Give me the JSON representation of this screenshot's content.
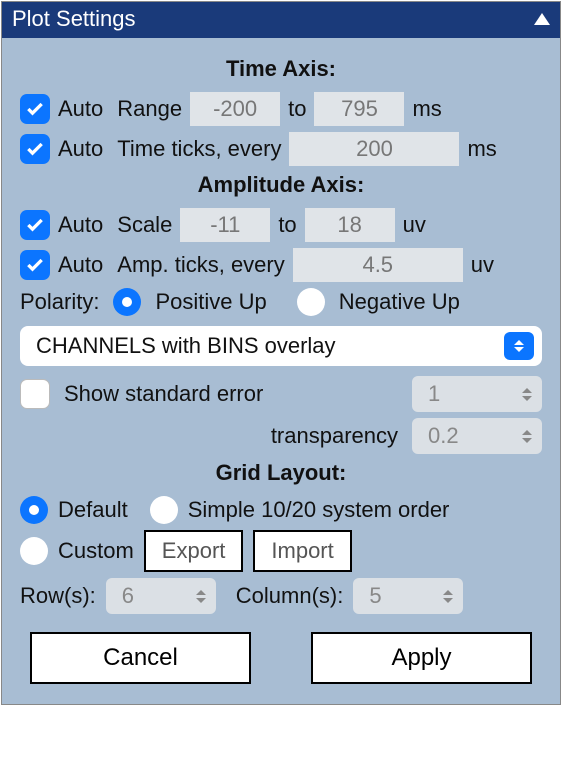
{
  "title": "Plot Settings",
  "time": {
    "heading": "Time Axis:",
    "auto_range": "Auto",
    "range_label": "Range",
    "range_from": "-200",
    "to_label": "to",
    "range_to": "795",
    "range_unit": "ms",
    "auto_ticks": "Auto",
    "ticks_label": "Time ticks, every",
    "ticks_value": "200",
    "ticks_unit": "ms"
  },
  "amp": {
    "heading": "Amplitude Axis:",
    "auto_scale": "Auto",
    "scale_label": "Scale",
    "scale_from": "-11",
    "to_label": "to",
    "scale_to": "18",
    "scale_unit": "uv",
    "auto_ticks": "Auto",
    "ticks_label": "Amp. ticks, every",
    "ticks_value": "4.5",
    "ticks_unit": "uv"
  },
  "polarity": {
    "label": "Polarity:",
    "pos": "Positive Up",
    "neg": "Negative Up"
  },
  "overlay_select": "CHANNELS with BINS overlay",
  "stderr": {
    "label": "Show standard error",
    "count": "1",
    "trans_label": "transparency",
    "trans_value": "0.2"
  },
  "grid": {
    "heading": "Grid Layout:",
    "default": "Default",
    "simple": "Simple 10/20 system order",
    "custom": "Custom",
    "export": "Export",
    "import": "Import",
    "rows_label": "Row(s):",
    "rows": "6",
    "cols_label": "Column(s):",
    "cols": "5"
  },
  "buttons": {
    "cancel": "Cancel",
    "apply": "Apply"
  }
}
